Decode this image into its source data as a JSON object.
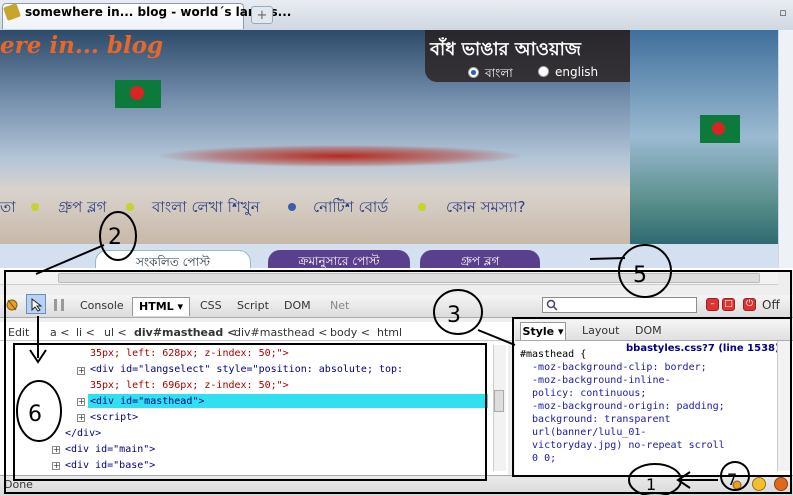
{
  "browser": {
    "tab_title": "somewhere in... blog - world´s larges...",
    "new_tab_symbol": "+",
    "maximize_symbol": "▫"
  },
  "site": {
    "logo": "ere in... blog",
    "bangla_title": "বাঁধ ভাঙার আওয়াজ",
    "languages": [
      {
        "label": "বাংলা",
        "selected": true
      },
      {
        "label": "english",
        "selected": false
      }
    ],
    "nav": [
      "তা",
      "গ্রুপ ব্লগ",
      "বাংলা লেখা শিখুন",
      "নোটিশ বোর্ড",
      "কোন সমস্যা?"
    ],
    "post_tabs": [
      "সংকলিত পোস্ট",
      "ক্রমানুসারে পোস্ট",
      "গ্রুপ ব্লগ"
    ]
  },
  "firebug": {
    "tabs": [
      "Console",
      "HTML ▾",
      "CSS",
      "Script",
      "DOM",
      "Net"
    ],
    "off_label": "Off",
    "breadcrumbs": [
      "Edit",
      "a <",
      "li <",
      "ul <",
      "div#masthead <",
      "div#masthead <",
      "body <",
      "html"
    ],
    "html_lines": [
      "35px; left: 628px; z-index: 50;\">",
      "<div id=\"langselect\" style=\"position: absolute; top:",
      "35px; left: 696px; z-index: 50;\">",
      "<div id=\"masthead\">",
      "<script>",
      "</div>",
      "<div id=\"main\">",
      "<div id=\"base\">"
    ],
    "side_tabs": [
      "Style ▾",
      "Layout",
      "DOM"
    ],
    "css_source": "bbastyles.css?7 (line 1538)",
    "css_lines": [
      "#masthead {",
      "  -moz-background-clip: border;",
      "  -moz-background-inline-",
      "  policy: continuous;",
      "  -moz-background-origin: padding;",
      "  background: transparent",
      "  url(banner/lulu_01-",
      "  victoryday.jpg) no-repeat scroll",
      "  0 0;"
    ]
  },
  "status": {
    "text": "Done"
  },
  "annotations": [
    "2",
    "5",
    "3",
    "6",
    "1",
    "7"
  ]
}
